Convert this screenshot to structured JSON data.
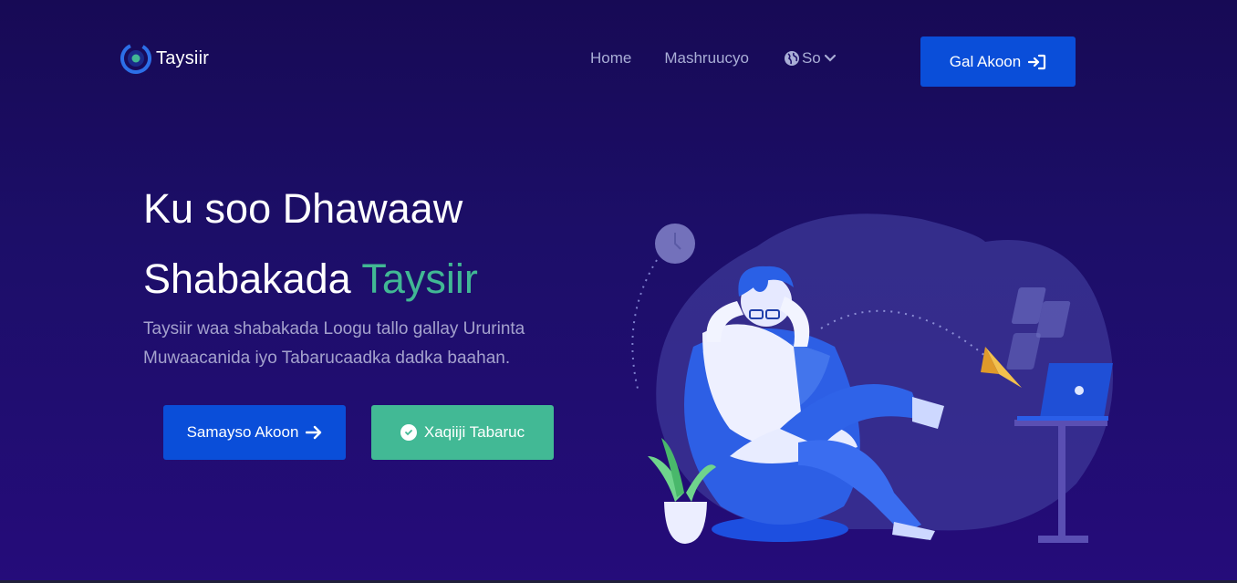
{
  "brand": {
    "name": "Taysiir",
    "logo_icon": "ring-logo-icon"
  },
  "nav": {
    "links": [
      {
        "label": "Home"
      },
      {
        "label": "Mashruucyo"
      }
    ],
    "language": {
      "label": "So",
      "icon": "globe-icon",
      "caret_icon": "chevron-down-icon"
    },
    "login": {
      "label": "Gal Akoon",
      "icon": "sign-in-icon"
    }
  },
  "hero": {
    "title_line1": "Ku soo Dhawaaw",
    "title_line2_prefix": "Shabakada ",
    "title_line2_accent": "Taysiir",
    "description": "Taysiir waa shabakada Loogu tallo gallay Ururinta Muwaacanida iyo Tabarucaadka dadka baahan.",
    "primary_button": {
      "label": "Samayso Akoon",
      "icon": "arrow-right-icon"
    },
    "secondary_button": {
      "label": "Xaqiiji Tabaruc",
      "icon": "check-circle-icon"
    }
  },
  "colors": {
    "background": "#1c0e68",
    "primary": "#0a4ed9",
    "accent": "#41b894",
    "muted_text": "#a4a2cd"
  }
}
